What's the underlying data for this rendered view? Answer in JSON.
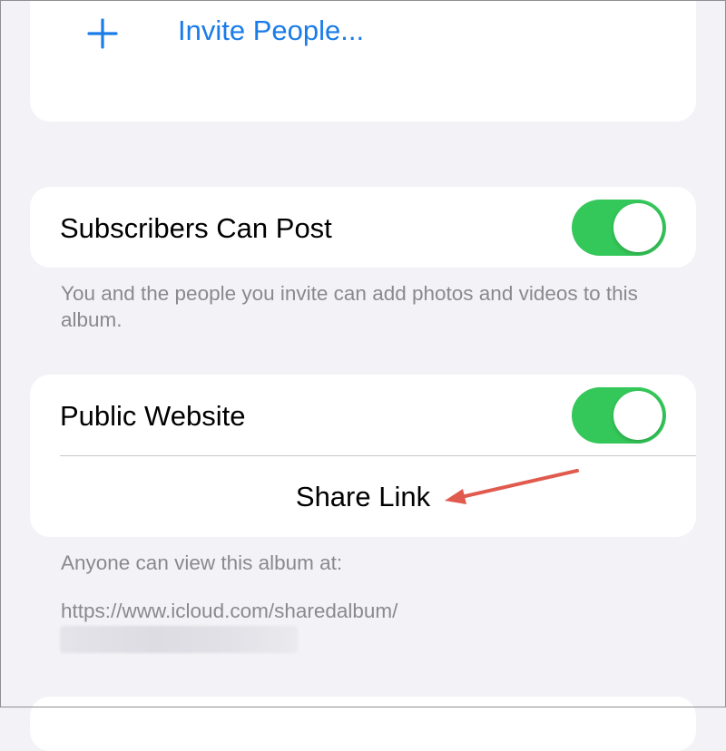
{
  "invite": {
    "label": "Invite People...",
    "icon": "plus-icon"
  },
  "subscribers": {
    "label": "Subscribers Can Post",
    "toggle_on": true,
    "footnote": "You and the people you invite can add photos and videos to this album."
  },
  "public_website": {
    "label": "Public Website",
    "toggle_on": true,
    "share_link_label": "Share Link",
    "footnote": "Anyone can view this album at:",
    "url": "https://www.icloud.com/sharedalbum/"
  },
  "colors": {
    "accent_blue": "#1A7CE8",
    "toggle_green": "#34C759",
    "background": "#F2F2F7",
    "secondary_text": "#8A8A8E",
    "annotation_arrow": "#E05A4E"
  }
}
